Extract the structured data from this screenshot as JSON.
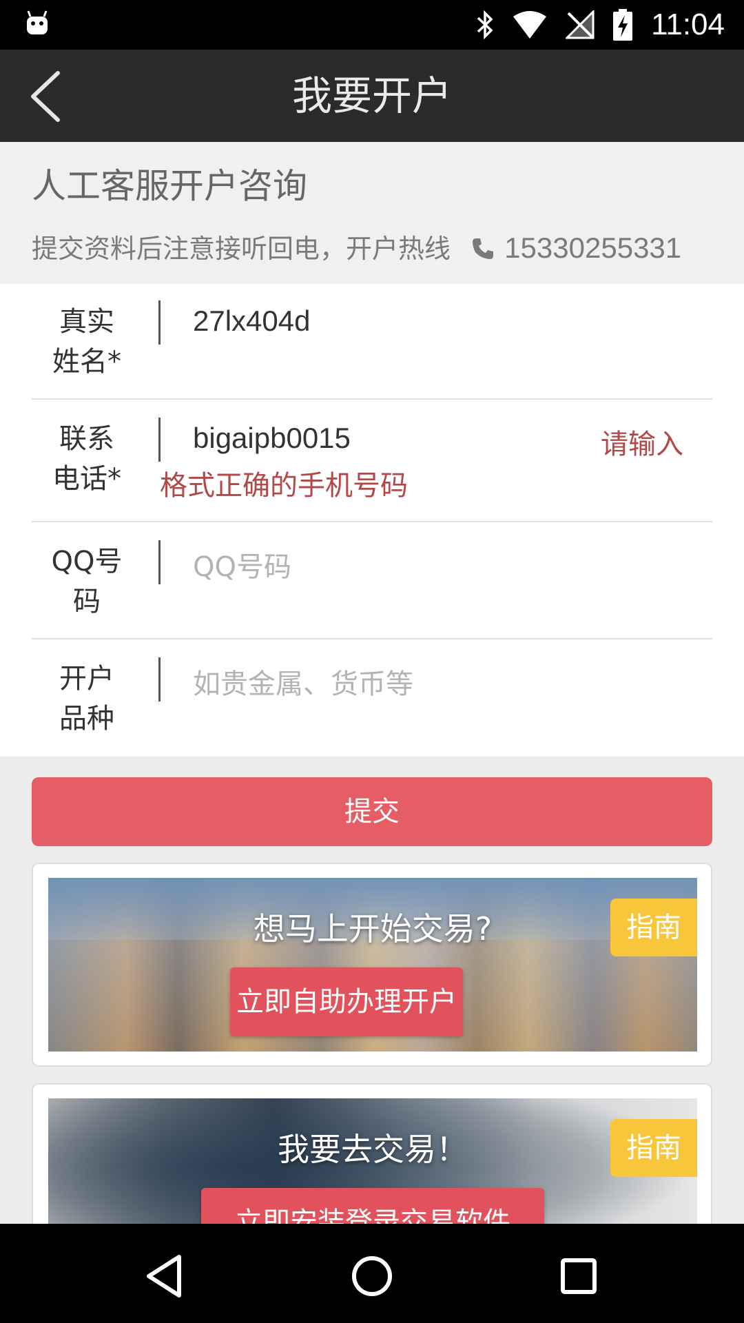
{
  "status_bar": {
    "time": "11:04",
    "icons": [
      "android-debug-icon",
      "bluetooth-icon",
      "wifi-icon",
      "no-signal-icon",
      "battery-charging-icon"
    ]
  },
  "app_bar": {
    "title": "我要开户",
    "back_icon": "chevron-left-icon"
  },
  "consult": {
    "title": "人工客服开户咨询",
    "subtitle": "提交资料后注意接听回电，开户热线",
    "hotline": "15330255331"
  },
  "form": {
    "name": {
      "label_line1": "真实",
      "label_line2": "姓名*",
      "value": "27lx404d"
    },
    "phone": {
      "label_line1": "联系",
      "label_line2": "电话*",
      "value": "bigaipb0015",
      "error_part1": "请输入",
      "error_part2": "格式正确的手机号码"
    },
    "qq": {
      "label_line1": "QQ号",
      "label_line2": "码",
      "placeholder": "QQ号码"
    },
    "product": {
      "label_line1": "开户",
      "label_line2": "品种",
      "placeholder": "如贵金属、货币等"
    }
  },
  "submit_label": "提交",
  "cards": [
    {
      "title": "想马上开始交易?",
      "button": "立即自助办理开户",
      "badge": "指南"
    },
    {
      "title": "我要去交易！",
      "button": "立即安装登录交易软件",
      "badge": "指南"
    }
  ],
  "colors": {
    "app_bar": "#2b2b2b",
    "submit": "#e55e66",
    "error": "#b34848",
    "badge": "#f8c63a"
  }
}
